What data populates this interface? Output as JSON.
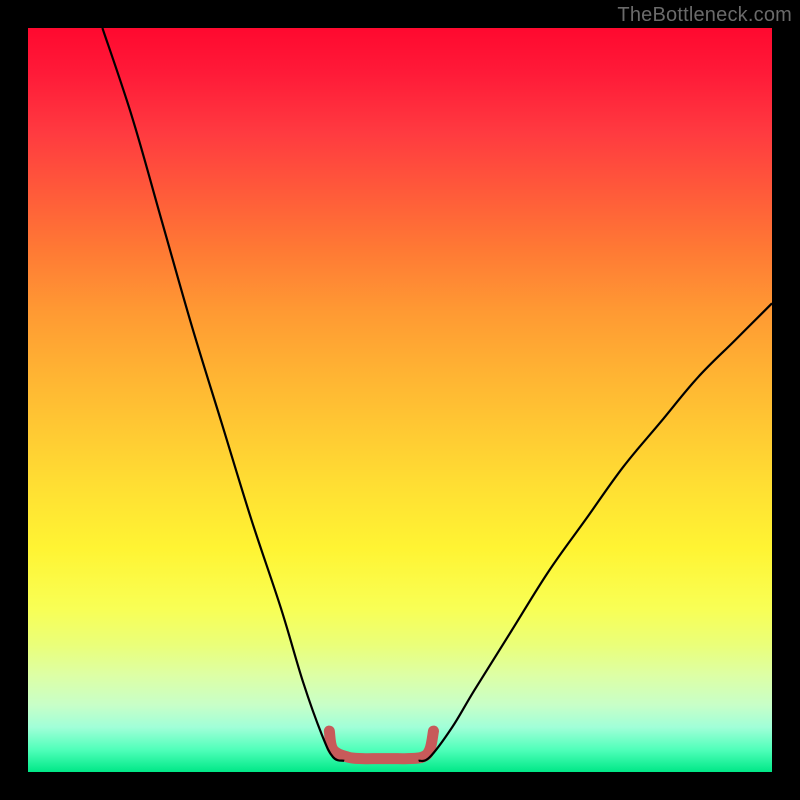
{
  "watermark": {
    "text": "TheBottleneck.com"
  },
  "chart_data": {
    "type": "line",
    "title": "",
    "xlabel": "",
    "ylabel": "",
    "xlim": [
      0,
      100
    ],
    "ylim": [
      0,
      100
    ],
    "grid": false,
    "series": [
      {
        "name": "left-curve",
        "x": [
          10,
          14,
          18,
          22,
          26,
          30,
          34,
          37,
          39.5,
          41,
          42.5
        ],
        "values": [
          100,
          88,
          74,
          60,
          47,
          34,
          22,
          12,
          5,
          2,
          1.5
        ]
      },
      {
        "name": "bottom-bracket",
        "x": [
          40.5,
          41,
          43,
          45,
          47,
          49,
          51,
          53,
          54,
          54.5
        ],
        "values": [
          5.5,
          3,
          2,
          1.8,
          1.8,
          1.8,
          1.8,
          2,
          3,
          5.5
        ]
      },
      {
        "name": "right-curve",
        "x": [
          52.5,
          54,
          57,
          60,
          65,
          70,
          75,
          80,
          85,
          90,
          95,
          100
        ],
        "values": [
          1.5,
          2,
          6,
          11,
          19,
          27,
          34,
          41,
          47,
          53,
          58,
          63
        ]
      }
    ],
    "annotations": []
  },
  "colors": {
    "curve": "#000000",
    "bracket": "#c75a5a",
    "background_frame": "#000000"
  }
}
